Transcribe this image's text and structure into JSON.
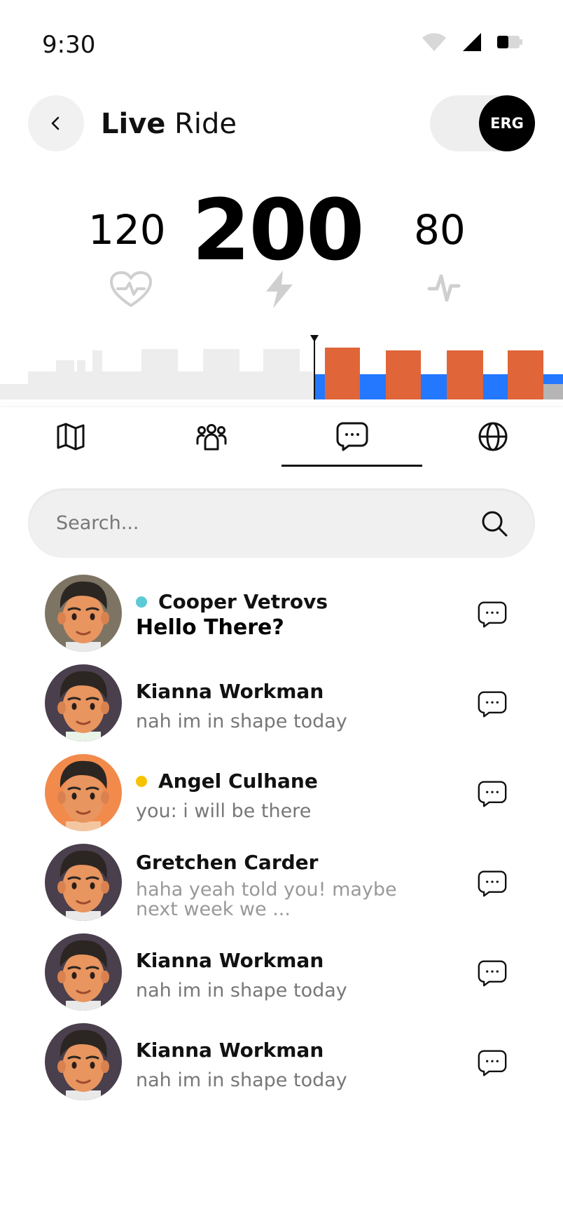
{
  "status": {
    "time": "9:30"
  },
  "header": {
    "title_bold": "Live",
    "title_light": "Ride",
    "erg_label": "ERG"
  },
  "metrics": {
    "heart_rate": "120",
    "power": "200",
    "cadence": "80"
  },
  "search": {
    "placeholder": "Search..."
  },
  "colors": {
    "accent_orange": "#E06539",
    "accent_blue": "#2478FF",
    "online_teal": "#5BC9D6",
    "away_yellow": "#F7C300"
  },
  "chats": [
    {
      "name": "Cooper Vetrovs",
      "message": "Hello There?",
      "status": "online",
      "unread": true
    },
    {
      "name": "Kianna Workman",
      "message": "nah im in shape today",
      "status": "none",
      "unread": false
    },
    {
      "name": "Angel Culhane",
      "message": "you: i will be there",
      "status": "away",
      "unread": false
    },
    {
      "name": "Gretchen Carder",
      "message": "haha yeah told you! maybe next week we ...",
      "status": "none",
      "unread": false
    },
    {
      "name": "Kianna Workman",
      "message": "nah im in shape today",
      "status": "none",
      "unread": false
    },
    {
      "name": "Kianna Workman",
      "message": "nah im in shape today",
      "status": "none",
      "unread": false
    }
  ]
}
